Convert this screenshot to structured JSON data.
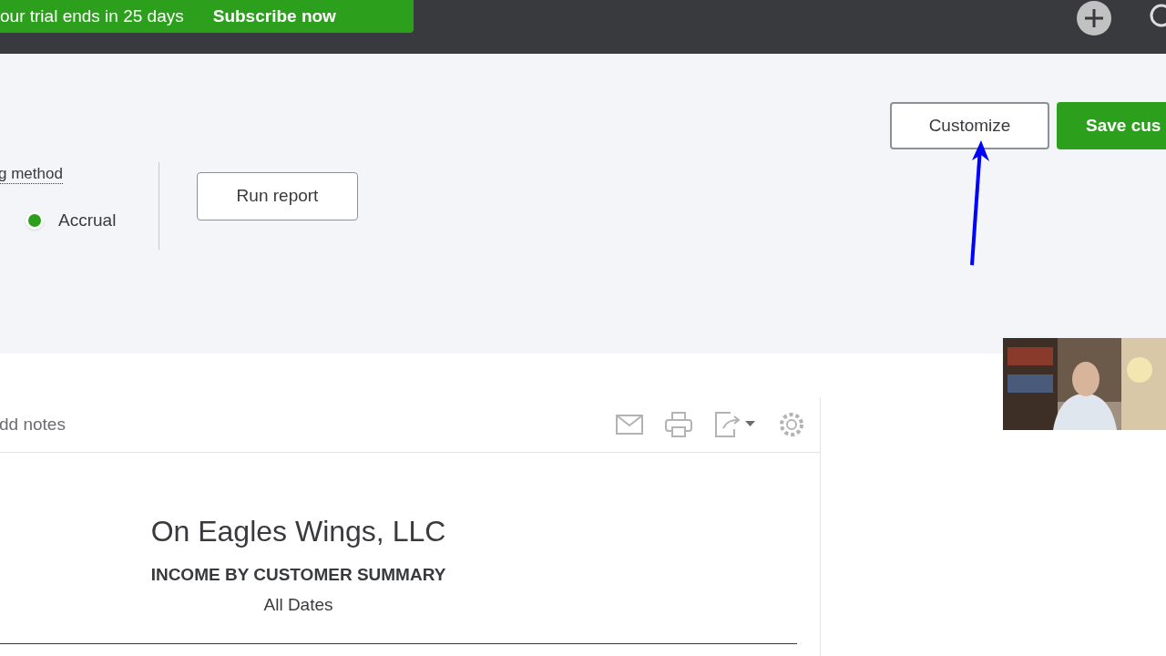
{
  "top_bar": {
    "trial_text": "our trial ends in 25 days",
    "subscribe": "Subscribe now"
  },
  "toolbar": {
    "customize": "Customize",
    "save": "Save cus"
  },
  "options": {
    "method_label": "g method",
    "radio": {
      "label": "Accrual",
      "selected": true
    },
    "run": "Run report"
  },
  "report": {
    "notes": "dd notes",
    "company": "On Eagles Wings, LLC",
    "title": "INCOME BY CUSTOMER SUMMARY",
    "period": "All Dates"
  }
}
